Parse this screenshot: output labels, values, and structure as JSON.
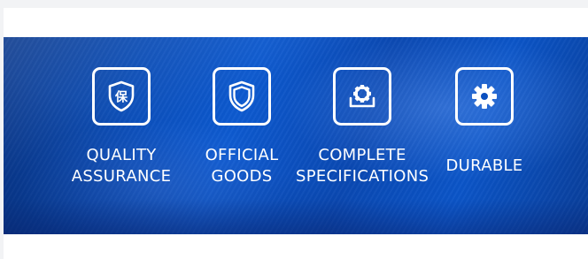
{
  "features": [
    {
      "icon": "shield-bao-icon",
      "icon_glyph": "保",
      "label_line1": "QUALITY",
      "label_line2": "ASSURANCE"
    },
    {
      "icon": "shield-icon",
      "label_line1": "OFFICIAL",
      "label_line2": "GOODS"
    },
    {
      "icon": "gear-tray-icon",
      "label_line1": "COMPLETE",
      "label_line2": "SPECIFICATIONS"
    },
    {
      "icon": "gear-icon",
      "label_line1": "DURABLE"
    }
  ],
  "colors": {
    "banner_blue": "#0a4db8",
    "icon_stroke": "#ffffff",
    "label_text": "#ffffff"
  }
}
